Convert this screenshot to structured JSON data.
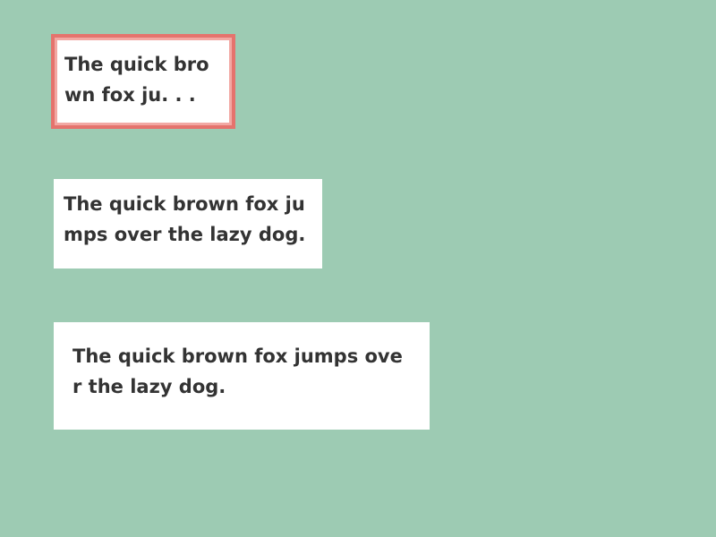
{
  "cards": [
    {
      "text": "The quick bro wn fox ju. . .",
      "selected": true
    },
    {
      "text": "The quick brown fox ju mps over the lazy dog.",
      "selected": false
    },
    {
      "text": "The quick brown fox jumps ove r the lazy dog.",
      "selected": false
    }
  ],
  "colors": {
    "background": "#9dcbb3",
    "card": "#ffffff",
    "text": "#333333",
    "selection_border": "#e5736d"
  }
}
